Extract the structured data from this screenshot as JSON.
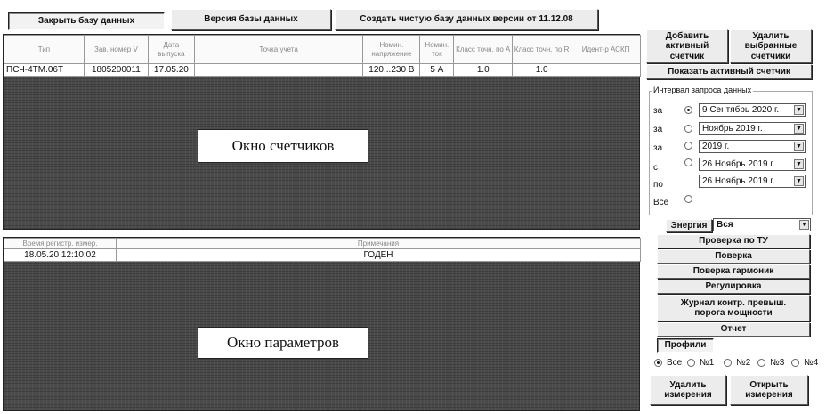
{
  "toolbar": {
    "close_db": "Закрыть базу данных",
    "db_version": "Версия базы данных",
    "create_clean_db": "Создать чистую базу данных версии от 11.12.08"
  },
  "meters_table": {
    "headers": [
      "Тип",
      "Зав. номер V",
      "Дата выпуска",
      "Точка учета",
      "Номин. напряжение",
      "Номин. ток",
      "Класс точн. по A",
      "Класс точн. по R",
      "Идент-р АСКП"
    ],
    "rows": [
      [
        "ПСЧ-4ТМ.06Т",
        "1805200011",
        "17.05.20",
        "",
        "120...230 В",
        "5 А",
        "1.0",
        "1.0",
        ""
      ]
    ]
  },
  "meters_window_label": "Окно счетчиков",
  "params_table": {
    "headers": [
      "Время регистр. измер.",
      "Примечания"
    ],
    "rows": [
      [
        "18.05.20 12:10:02",
        "ГОДЕН"
      ]
    ]
  },
  "params_window_label": "Окно параметров",
  "sidebar": {
    "add_active_meter": "Добавить\nактивный\nсчетчик",
    "delete_selected": "Удалить\nвыбранные\nсчетчики",
    "show_active_meter": "Показать активный счетчик",
    "interval_title": "Интервал запроса данных",
    "interval_rows": [
      {
        "label": "за",
        "value": "9 Сентябрь 2020 г.",
        "selected": true
      },
      {
        "label": "за",
        "value": "Ноябрь  2019 г.",
        "selected": false
      },
      {
        "label": "за",
        "value": "2019 г.",
        "selected": false
      },
      {
        "label": "с",
        "value": "26  Ноябрь  2019 г.",
        "selected": false
      },
      {
        "label": "по",
        "value": "26  Ноябрь  2019 г.",
        "selected": false
      },
      {
        "label": "Всё",
        "value": "",
        "selected": false
      }
    ],
    "energy_label": "Энергия",
    "energy_value": "Вся",
    "check_tu": "Проверка по ТУ",
    "verification": "Поверка",
    "harmonics_verification": "Поверка гармоник",
    "adjustment": "Регулировка",
    "power_log": "Журнал контр. превыш.\nпорога мощности",
    "report": "Отчет",
    "profiles": "Профили",
    "profile_options": [
      "Все",
      "№1",
      "№2",
      "№3",
      "№4"
    ],
    "delete_measurements": "Удалить\nизмерения",
    "open_measurements": "Открыть\nизмерения"
  }
}
